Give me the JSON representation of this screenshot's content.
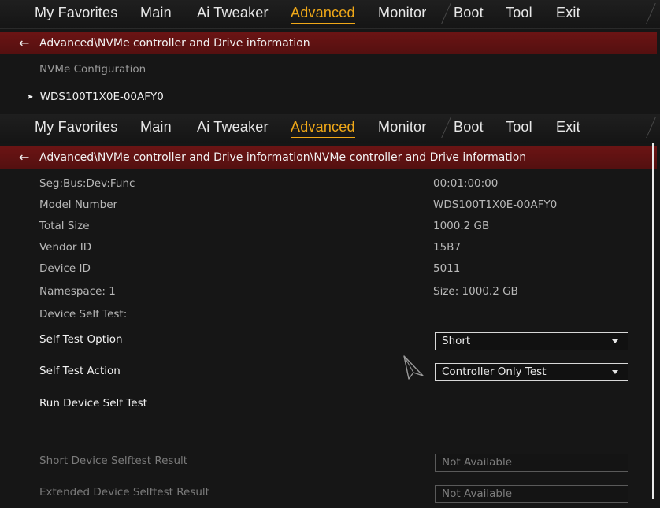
{
  "top_menu": {
    "tabs": [
      {
        "label": "My Favorites"
      },
      {
        "label": "Main"
      },
      {
        "label": "Ai Tweaker"
      },
      {
        "label": "Advanced"
      },
      {
        "label": "Monitor"
      },
      {
        "label": "Boot"
      },
      {
        "label": "Tool"
      },
      {
        "label": "Exit"
      }
    ],
    "active_tab": "Advanced",
    "active_color": "#f0a818"
  },
  "screen1": {
    "breadcrumb": "Advanced\\NVMe controller and Drive information",
    "section_label": "NVMe Configuration",
    "drive_item": "WDS100T1X0E-00AFY0"
  },
  "screen2": {
    "breadcrumb": "Advanced\\NVMe controller and Drive information\\NVMe controller and Drive information",
    "info": [
      {
        "label": "Seg:Bus:Dev:Func",
        "value": "00:01:00:00"
      },
      {
        "label": "Model Number",
        "value": "WDS100T1X0E-00AFY0"
      },
      {
        "label": "Total Size",
        "value": "1000.2 GB"
      },
      {
        "label": "Vendor ID",
        "value": "15B7"
      },
      {
        "label": "Device ID",
        "value": "5011"
      },
      {
        "label": "Namespace: 1",
        "value": "Size: 1000.2 GB"
      }
    ],
    "self_test_heading": "Device Self Test:",
    "self_test_option": {
      "label": "Self Test Option",
      "value": "Short"
    },
    "self_test_action": {
      "label": "Self Test Action",
      "value": "Controller Only Test"
    },
    "run_label": "Run Device Self Test",
    "short_result": {
      "label": "Short Device Selftest Result",
      "value": "Not Available"
    },
    "extended_result": {
      "label": "Extended Device Selftest Result",
      "value": "Not Available"
    }
  },
  "colors": {
    "breadcrumb_bg": "#5e1212",
    "background": "#161616"
  },
  "icons": {
    "back": "left-arrow-icon",
    "expand": "chevron-right-icon",
    "dropdown": "caret-down-icon",
    "cursor": "mouse-pointer-icon"
  }
}
